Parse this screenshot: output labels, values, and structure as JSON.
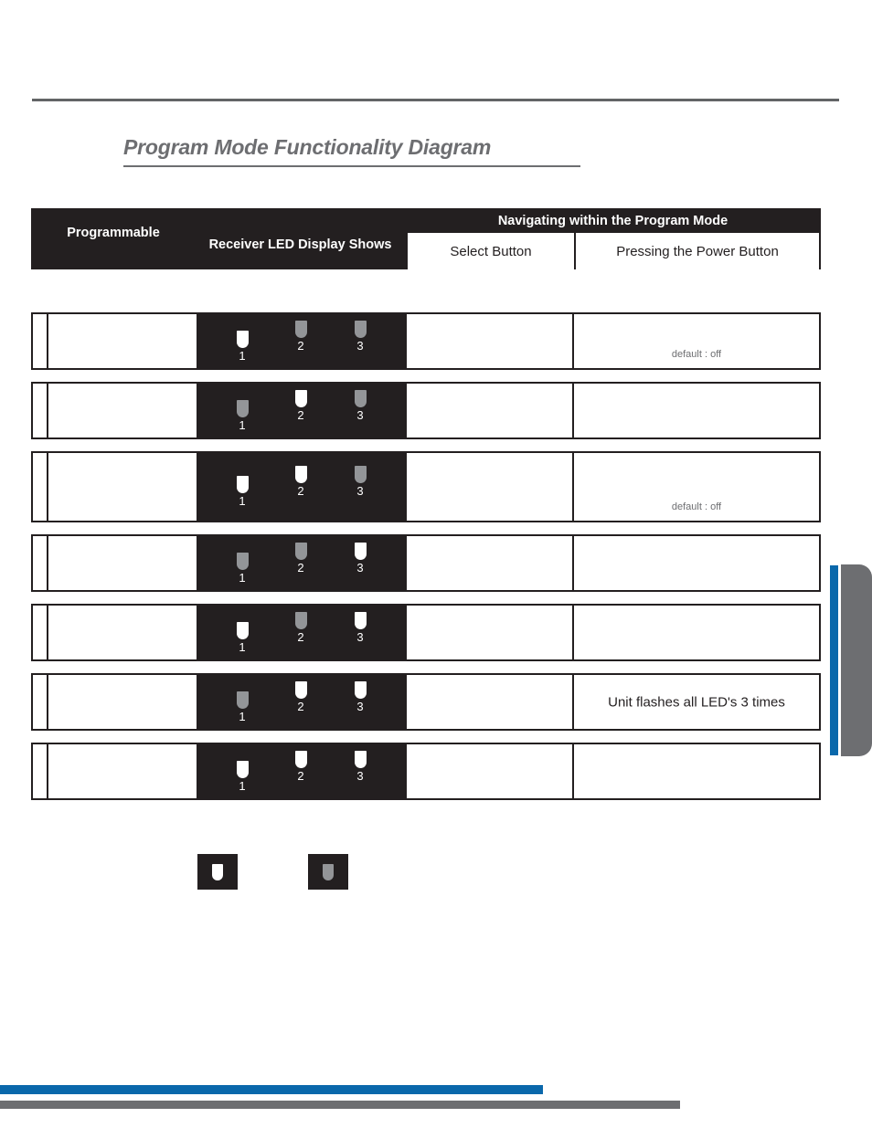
{
  "page": {
    "title": "Program Mode Functionality Diagram"
  },
  "table": {
    "header": {
      "programmable": "Programmable",
      "receiver": "Receiver LED Display Shows",
      "navigating": "Navigating within the Program Mode",
      "select_button": "Select Button",
      "power_button": "Pressing the Power Button"
    },
    "rows": [
      {
        "index": "",
        "programmable": "",
        "leds": [
          "on",
          "off",
          "off"
        ],
        "led_labels": [
          "1",
          "2",
          "3"
        ],
        "select": "",
        "power": "default : off",
        "power_style": "small"
      },
      {
        "index": "",
        "programmable": "",
        "leds": [
          "off",
          "on",
          "off"
        ],
        "led_labels": [
          "1",
          "2",
          "3"
        ],
        "select": "",
        "power": "",
        "power_style": "small"
      },
      {
        "index": "",
        "programmable": "",
        "leds": [
          "on",
          "on",
          "off"
        ],
        "led_labels": [
          "1",
          "2",
          "3"
        ],
        "select": "",
        "power": "default : off",
        "power_style": "small"
      },
      {
        "index": "",
        "programmable": "",
        "leds": [
          "off",
          "off",
          "on"
        ],
        "led_labels": [
          "1",
          "2",
          "3"
        ],
        "select": "",
        "power": "",
        "power_style": "small"
      },
      {
        "index": "",
        "programmable": "",
        "leds": [
          "on",
          "off",
          "on"
        ],
        "led_labels": [
          "1",
          "2",
          "3"
        ],
        "select": "",
        "power": "",
        "power_style": "small"
      },
      {
        "index": "",
        "programmable": "",
        "leds": [
          "off",
          "on",
          "on"
        ],
        "led_labels": [
          "1",
          "2",
          "3"
        ],
        "select": "",
        "power": "Unit flashes all LED's 3 times",
        "power_style": "center"
      },
      {
        "index": "",
        "programmable": "",
        "leds": [
          "on",
          "on",
          "on"
        ],
        "led_labels": [
          "1",
          "2",
          "3"
        ],
        "select": "",
        "power": "",
        "power_style": "small"
      }
    ]
  },
  "legend": {
    "on_swatch": "led-on-swatch",
    "off_swatch": "led-off-swatch"
  },
  "colors": {
    "panel_black": "#231f20",
    "led_on": "#ffffff",
    "led_off": "#939598",
    "accent_blue": "#0a68ab",
    "accent_gray": "#6d6e71"
  }
}
